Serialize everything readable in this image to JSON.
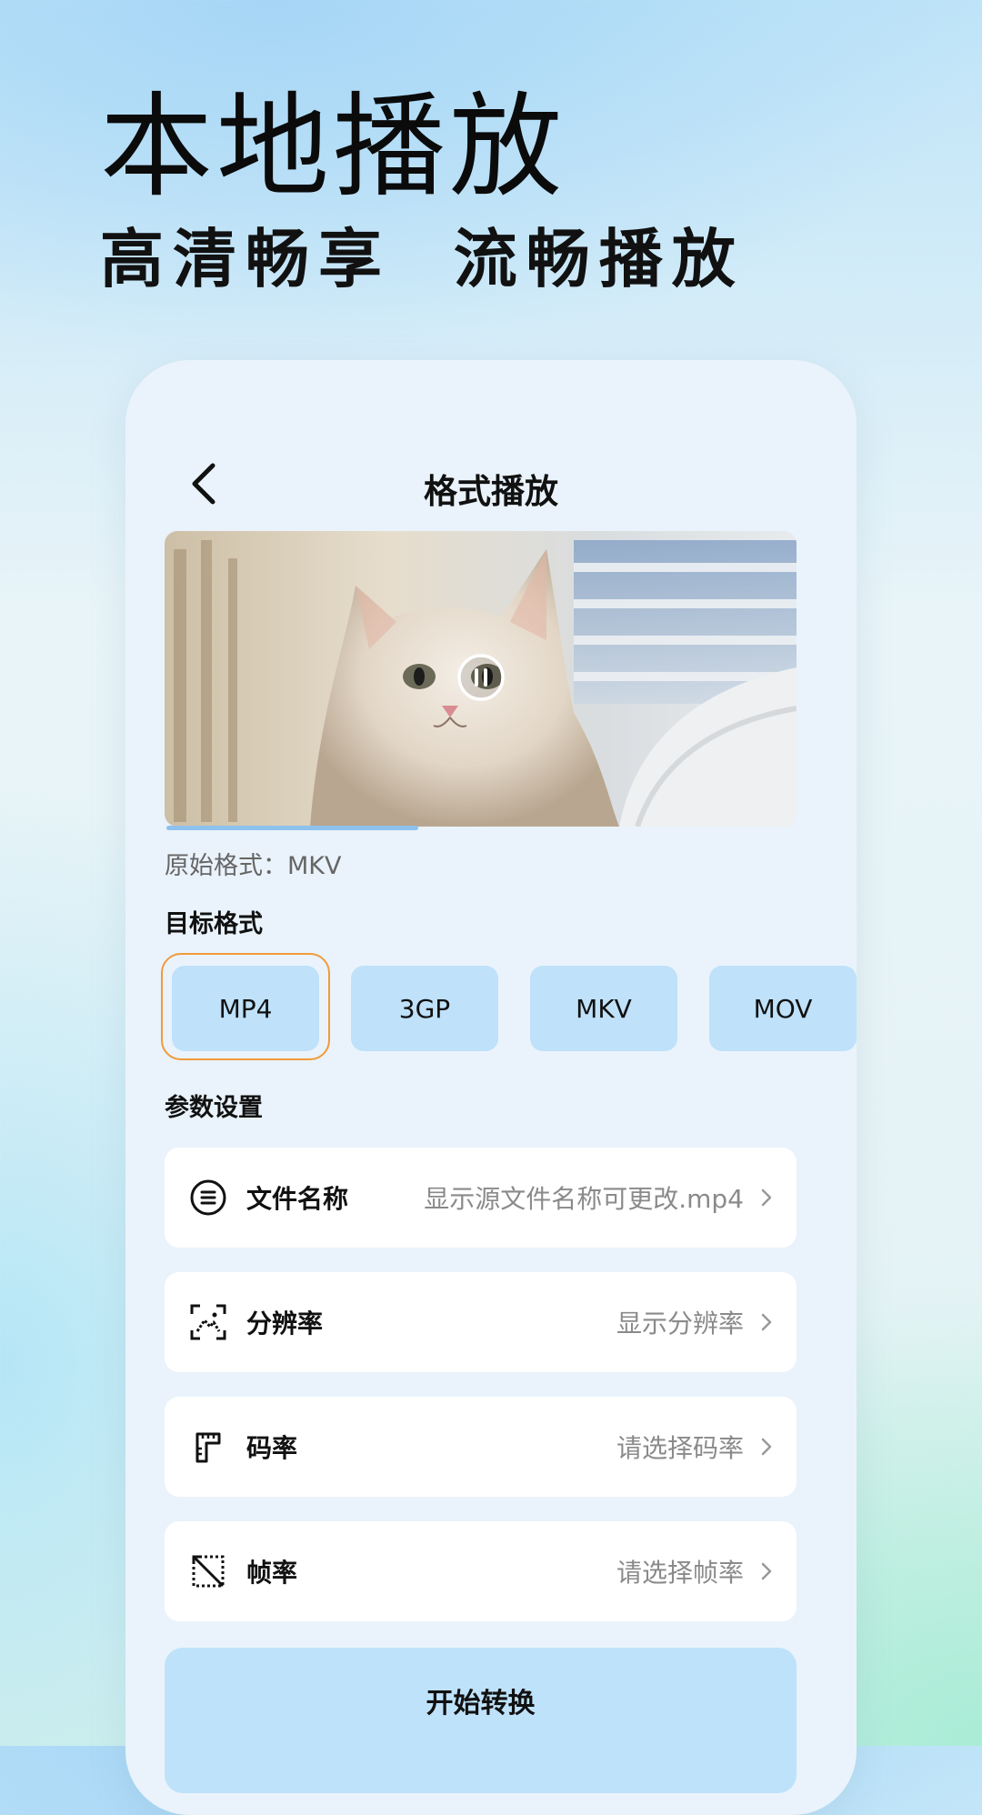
{
  "hero": {
    "title": "本地播放",
    "subtitle": "高清畅享  流畅播放"
  },
  "header": {
    "title": "格式播放",
    "back_icon": "chevron-left-icon"
  },
  "player": {
    "state_icon": "pause-icon",
    "progress": 0.4
  },
  "source": {
    "label": "原始格式：MKV"
  },
  "target": {
    "label": "目标格式",
    "options": [
      "MP4",
      "3GP",
      "MKV",
      "MOV"
    ],
    "selected": "MP4",
    "selected_border_color": "#f29a3a"
  },
  "params": {
    "label": "参数设置",
    "rows": [
      {
        "icon": "file-name-icon",
        "label": "文件名称",
        "value": "显示源文件名称可更改.mp4"
      },
      {
        "icon": "resolution-icon",
        "label": "分辨率",
        "value": "显示分辨率"
      },
      {
        "icon": "bitrate-icon",
        "label": "码率",
        "value": "请选择码率"
      },
      {
        "icon": "framerate-icon",
        "label": "帧率",
        "value": "请选择帧率"
      }
    ]
  },
  "action": {
    "convert_label": "开始转换"
  },
  "colors": {
    "accent_button": "#bfe1fa",
    "selected_border": "#f29a3a"
  }
}
